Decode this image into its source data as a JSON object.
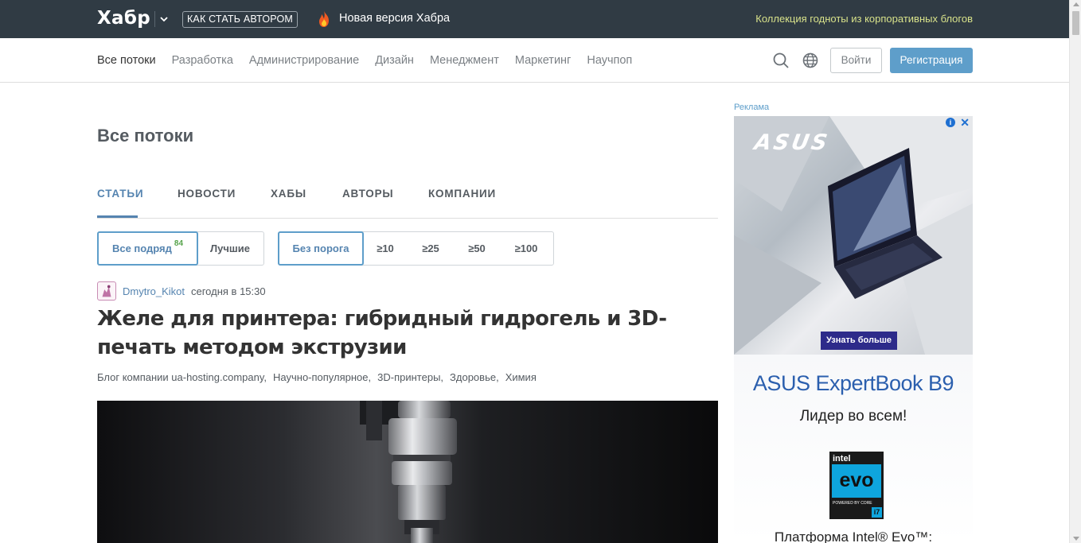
{
  "topbar": {
    "logo": "Хабр",
    "author_button": "КАК СТАТЬ АВТОРОМ",
    "new_version": "Новая версия Хабра",
    "promo": "Коллекция годноты из корпоративных блогов"
  },
  "nav": {
    "items": [
      "Все потоки",
      "Разработка",
      "Администрирование",
      "Дизайн",
      "Менеджмент",
      "Маркетинг",
      "Научпоп"
    ],
    "login": "Войти",
    "register": "Регистрация"
  },
  "page": {
    "title": "Все потоки",
    "tabs": [
      "СТАТЬИ",
      "НОВОСТИ",
      "ХАБЫ",
      "АВТОРЫ",
      "КОМПАНИИ"
    ]
  },
  "filters": {
    "sort": {
      "all": "Все подряд",
      "count": "84",
      "best": "Лучшие"
    },
    "rating": [
      "Без порога",
      "≥10",
      "≥25",
      "≥50",
      "≥100"
    ]
  },
  "post": {
    "author": "Dmytro_Kikot",
    "time": "сегодня в 15:30",
    "title": "Желе для принтера: гибридный гидрогель и 3D-печать методом экструзии",
    "hubs": [
      "Блог компании ua-hosting.company,",
      "Научно-популярное,",
      "3D-принтеры,",
      "Здоровье,",
      "Химия"
    ]
  },
  "ad": {
    "label": "Реклама",
    "brand": "ASUS",
    "cta": "Узнать больше",
    "product": "ASUS ExpertBook B9",
    "tagline": "Лидер во всем!",
    "badge_intel": "intel",
    "badge_evo": "evo",
    "badge_core": "POWERED BY CORE",
    "badge_i7": "i7",
    "platform": "Платформа Intel® Evo™:"
  },
  "colors": {
    "topbar_bg": "#303b44",
    "accent": "#5e9eca",
    "link": "#5584b0",
    "promo": "#d8e28a",
    "badge_green": "#56a34b"
  }
}
